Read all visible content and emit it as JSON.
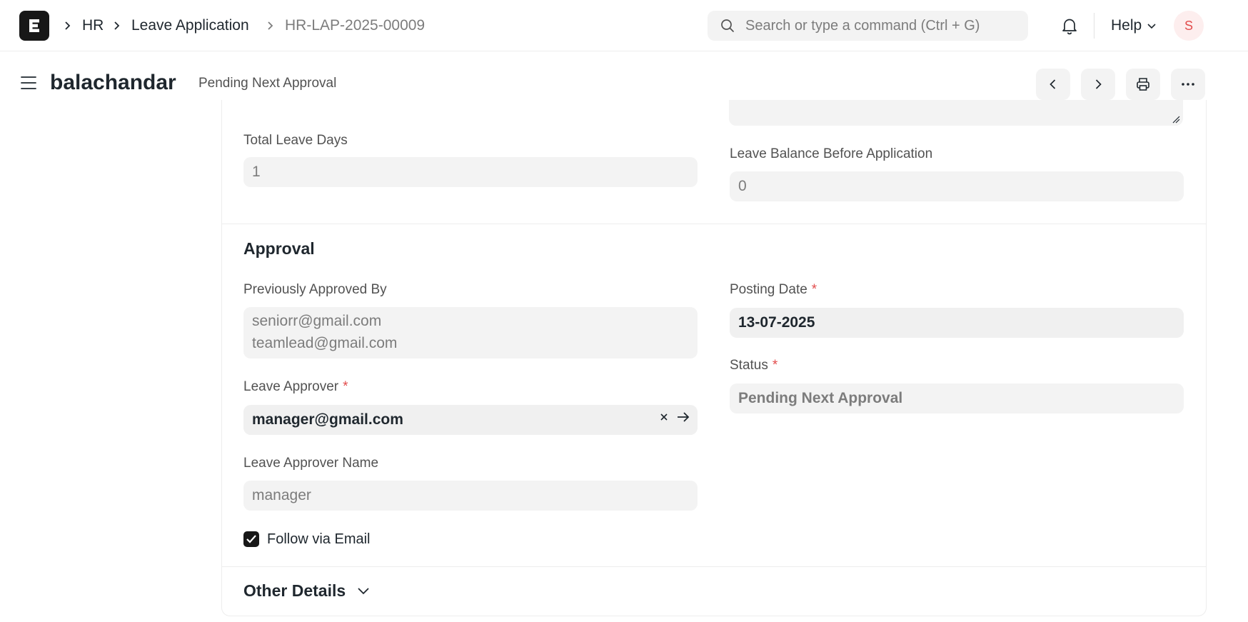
{
  "navbar": {
    "breadcrumbs": [
      "HR",
      "Leave Application",
      "HR-LAP-2025-00009"
    ],
    "search_placeholder": "Search or type a command (Ctrl + G)",
    "help_label": "Help",
    "avatar_initial": "S"
  },
  "header": {
    "title": "balachandar",
    "status": "Pending Next Approval"
  },
  "form": {
    "total_leave_days": {
      "label": "Total Leave Days",
      "value": "1"
    },
    "leave_balance": {
      "label": "Leave Balance Before Application",
      "value": "0"
    },
    "approval_section": {
      "title": "Approval",
      "previously_approved_by": {
        "label": "Previously Approved By",
        "values": [
          "seniorr@gmail.com",
          "teamlead@gmail.com"
        ]
      },
      "posting_date": {
        "label": "Posting Date",
        "value": "13-07-2025"
      },
      "status": {
        "label": "Status",
        "value": "Pending Next Approval"
      },
      "leave_approver": {
        "label": "Leave Approver",
        "value": "manager@gmail.com"
      },
      "leave_approver_name": {
        "label": "Leave Approver Name",
        "value": "manager"
      },
      "follow_via_email": {
        "label": "Follow via Email",
        "checked": true
      }
    },
    "other_details_section": {
      "title": "Other Details"
    },
    "required_marker": "*"
  },
  "colors": {
    "required": "#e24c4c",
    "accent_dark": "#171717",
    "field_bg": "#f3f3f3"
  }
}
